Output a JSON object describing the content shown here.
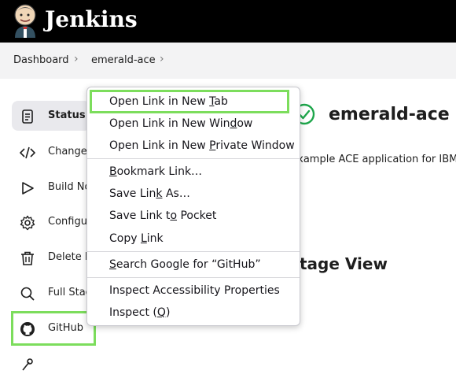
{
  "header": {
    "brand": "Jenkins"
  },
  "breadcrumb": {
    "items": [
      "Dashboard",
      "emerald-ace"
    ]
  },
  "sidebar": {
    "items": [
      {
        "label": "Status",
        "icon": "document-icon"
      },
      {
        "label": "Changes",
        "icon": "code-icon"
      },
      {
        "label": "Build Now",
        "icon": "play-icon"
      },
      {
        "label": "Configure",
        "icon": "gear-icon"
      },
      {
        "label": "Delete Pipeline",
        "icon": "trash-icon"
      },
      {
        "label": "Full Stage View",
        "icon": "search-icon"
      },
      {
        "label": "GitHub",
        "icon": "github-icon"
      }
    ]
  },
  "main": {
    "title": "emerald-ace",
    "description": "n example ACE application for IBM",
    "stage_view": "tage View"
  },
  "context_menu": {
    "items": [
      {
        "pre": "Open Link in New ",
        "ul": "T",
        "post": "ab"
      },
      {
        "pre": "Open Link in New Win",
        "ul": "d",
        "post": "ow"
      },
      {
        "pre": "Open Link in New ",
        "ul": "P",
        "post": "rivate Window"
      },
      {
        "pre": "",
        "ul": "B",
        "post": "ookmark Link…"
      },
      {
        "pre": "Save Lin",
        "ul": "k",
        "post": " As…"
      },
      {
        "pre": "Save Link t",
        "ul": "o",
        "post": " Pocket"
      },
      {
        "pre": "Copy ",
        "ul": "L",
        "post": "ink"
      },
      {
        "pre": "",
        "ul": "S",
        "post": "earch Google for “GitHub”"
      },
      {
        "pre": "Inspect Accessibility Properties",
        "ul": "",
        "post": ""
      },
      {
        "pre": "Inspect (",
        "ul": "Q",
        "post": ")"
      }
    ]
  },
  "colors": {
    "highlight": "#7cdd5c",
    "topbar": "#000000",
    "success": "#1ea64b"
  }
}
